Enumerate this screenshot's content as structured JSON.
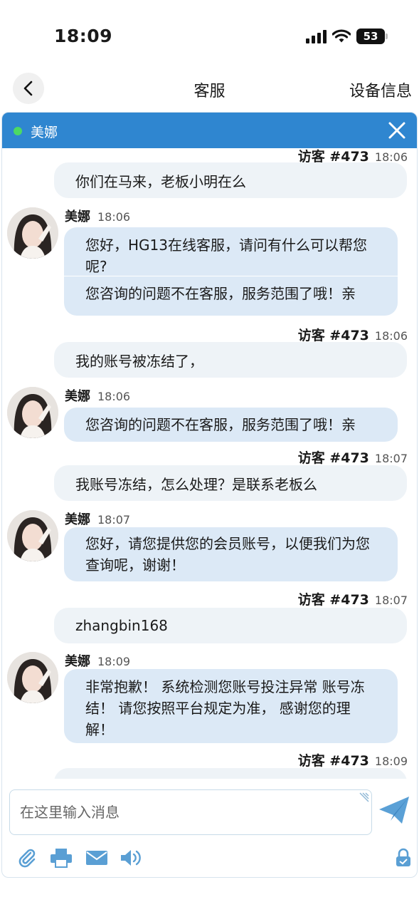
{
  "status_bar": {
    "time": "18:09",
    "battery": "53"
  },
  "nav": {
    "title": "客服",
    "right_label": "设备信息"
  },
  "chat": {
    "agent_name": "美娜",
    "messages": [
      {
        "sender": "visitor",
        "name": "访客 #473",
        "time": "18:06",
        "text": "你们在马来，老板小明在么"
      },
      {
        "sender": "agent",
        "name": "美娜",
        "time": "18:06",
        "texts": [
          "您好，HG13在线客服，请问有什么可以帮您呢?",
          "您咨询的问题不在客服，服务范围了哦！亲"
        ]
      },
      {
        "sender": "visitor",
        "name": "访客 #473",
        "time": "18:06",
        "text": "我的账号被冻结了，"
      },
      {
        "sender": "agent",
        "name": "美娜",
        "time": "18:06",
        "texts": [
          "您咨询的问题不在客服，服务范围了哦！亲"
        ]
      },
      {
        "sender": "visitor",
        "name": "访客 #473",
        "time": "18:07",
        "text": "我账号冻结，怎么处理？是联系老板么"
      },
      {
        "sender": "agent",
        "name": "美娜",
        "time": "18:07",
        "texts": [
          "您好，请您提供您的会员账号，以便我们为您查询呢，谢谢！"
        ]
      },
      {
        "sender": "visitor",
        "name": "访客 #473",
        "time": "18:07",
        "text": "zhangbin168"
      },
      {
        "sender": "agent",
        "name": "美娜",
        "time": "18:09",
        "texts": [
          "非常抱歉！ 系统检测您账号投注异常 账号冻结！ 请您按照平台规定为准， 感谢您的理解！"
        ]
      },
      {
        "sender": "visitor",
        "name": "访客 #473",
        "time": "18:09",
        "text": ""
      }
    ]
  },
  "composer": {
    "placeholder": "在这里输入消息"
  },
  "colors": {
    "header_blue": "#2f86d0",
    "agent_bubble": "#dce9f6",
    "visitor_bubble": "#eef3f7",
    "online": "#4cd964"
  },
  "icons": [
    "back-icon",
    "close-icon",
    "send-icon",
    "paperclip-icon",
    "printer-icon",
    "mail-icon",
    "speaker-icon",
    "lock-icon"
  ]
}
